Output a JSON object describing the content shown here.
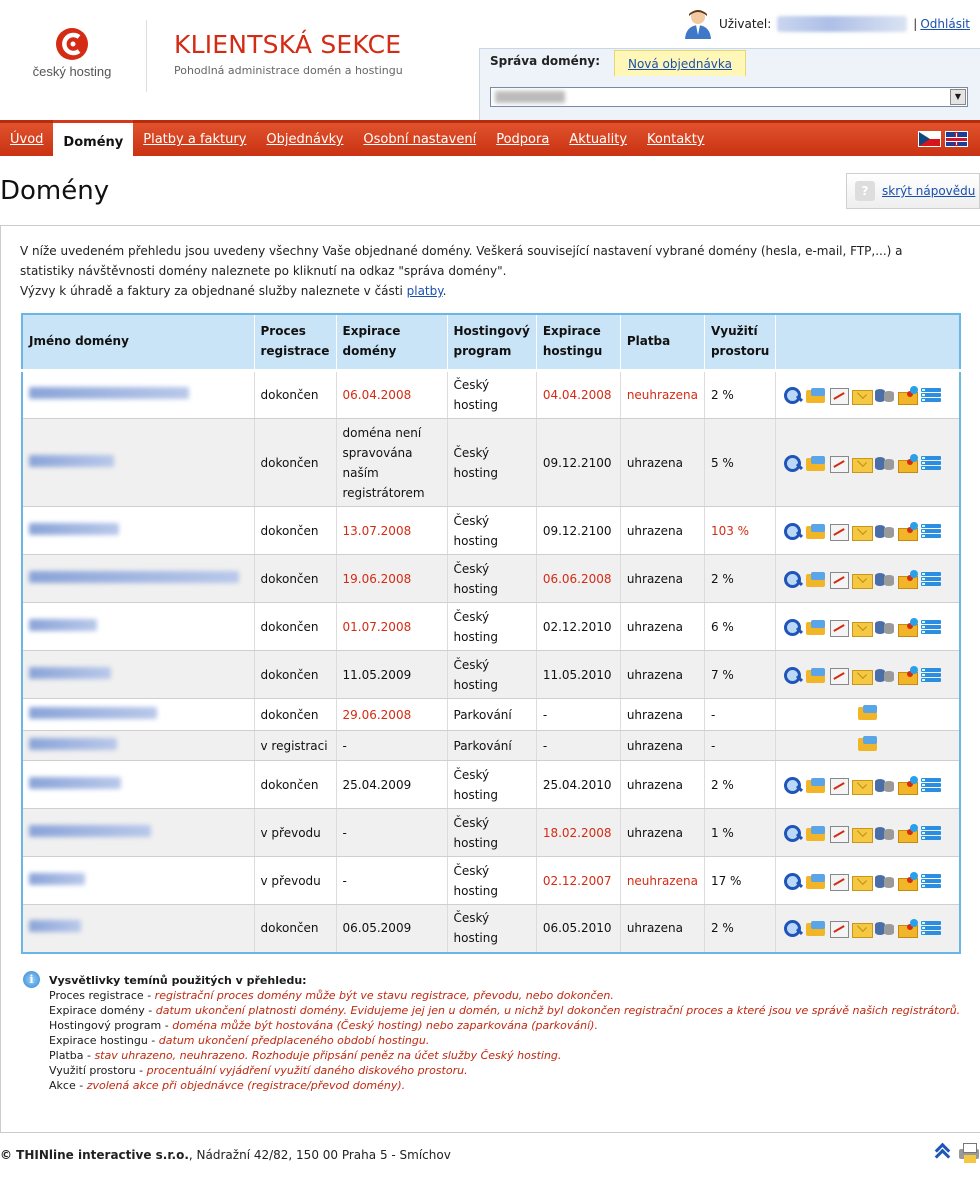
{
  "brand": {
    "logo_text": "český hosting",
    "title": "KLIENTSKÁ SEKCE",
    "subtitle": "Pohodlná administrace domén a hostingu"
  },
  "user": {
    "label": "Uživatel:",
    "separator": "|",
    "logout": "Odhlásit"
  },
  "domain_box": {
    "tab_manage": "Správa domény:",
    "tab_new_order": "Nová objednávka"
  },
  "nav": {
    "items": [
      {
        "label": "Úvod"
      },
      {
        "label": "Domény"
      },
      {
        "label": "Platby a faktury"
      },
      {
        "label": "Objednávky"
      },
      {
        "label": "Osobní nastavení"
      },
      {
        "label": "Podpora"
      },
      {
        "label": "Aktuality"
      },
      {
        "label": "Kontakty"
      }
    ],
    "active": "Domény"
  },
  "page": {
    "title": "Domény",
    "help_toggle": "skrýt nápovědu",
    "help_icon": "?"
  },
  "intro": {
    "line1": "V níže uvedeném přehledu jsou uvedeny všechny Vaše objednané domény. Veškerá související nastavení vybrané domény (hesla, e-mail, FTP,...) a statistiky návštěvnosti domény naleznete po kliknutí na odkaz \"správa domény\".",
    "line2_prefix": "Výzvy k úhradě a faktury za objednané služby naleznete v části ",
    "line2_link": "platby",
    "line2_suffix": "."
  },
  "table": {
    "headers": [
      "Jméno domény",
      "Proces registrace",
      "Expirace domény",
      "Hostingový program",
      "Expirace hostingu",
      "Platba",
      "Využití prostoru",
      ""
    ],
    "rows": [
      {
        "proc": "dokončen",
        "exp_dom": "06.04.2008",
        "exp_dom_red": true,
        "prog": "Český hosting",
        "exp_host": "04.04.2008",
        "exp_host_red": true,
        "platba": "neuhrazena",
        "platba_red": true,
        "vyuziti": "2 %",
        "vyuziti_red": false,
        "actions": "full"
      },
      {
        "proc": "dokončen",
        "exp_dom": "doména není spravována naším registrátorem",
        "exp_dom_red": false,
        "prog": "Český hosting",
        "exp_host": "09.12.2100",
        "exp_host_red": false,
        "platba": "uhrazena",
        "platba_red": false,
        "vyuziti": "5 %",
        "vyuziti_red": false,
        "actions": "full"
      },
      {
        "proc": "dokončen",
        "exp_dom": "13.07.2008",
        "exp_dom_red": true,
        "prog": "Český hosting",
        "exp_host": "09.12.2100",
        "exp_host_red": false,
        "platba": "uhrazena",
        "platba_red": false,
        "vyuziti": "103 %",
        "vyuziti_red": true,
        "actions": "full"
      },
      {
        "proc": "dokončen",
        "exp_dom": "19.06.2008",
        "exp_dom_red": true,
        "prog": "Český hosting",
        "exp_host": "06.06.2008",
        "exp_host_red": true,
        "platba": "uhrazena",
        "platba_red": false,
        "vyuziti": "2 %",
        "vyuziti_red": false,
        "actions": "full"
      },
      {
        "proc": "dokončen",
        "exp_dom": "01.07.2008",
        "exp_dom_red": true,
        "prog": "Český hosting",
        "exp_host": "02.12.2010",
        "exp_host_red": false,
        "platba": "uhrazena",
        "platba_red": false,
        "vyuziti": "6 %",
        "vyuziti_red": false,
        "actions": "full"
      },
      {
        "proc": "dokončen",
        "exp_dom": "11.05.2009",
        "exp_dom_red": false,
        "prog": "Český hosting",
        "exp_host": "11.05.2010",
        "exp_host_red": false,
        "platba": "uhrazena",
        "platba_red": false,
        "vyuziti": "7 %",
        "vyuziti_red": false,
        "actions": "full"
      },
      {
        "proc": "dokončen",
        "exp_dom": "29.06.2008",
        "exp_dom_red": true,
        "prog": "Parkování",
        "exp_host": "-",
        "exp_host_red": false,
        "platba": "uhrazena",
        "platba_red": false,
        "vyuziti": "-",
        "vyuziti_red": false,
        "actions": "folder"
      },
      {
        "proc": "v registraci",
        "exp_dom": "-",
        "exp_dom_red": false,
        "prog": "Parkování",
        "exp_host": "-",
        "exp_host_red": false,
        "platba": "uhrazena",
        "platba_red": false,
        "vyuziti": "-",
        "vyuziti_red": false,
        "actions": "folder"
      },
      {
        "proc": "dokončen",
        "exp_dom": "25.04.2009",
        "exp_dom_red": false,
        "prog": "Český hosting",
        "exp_host": "25.04.2010",
        "exp_host_red": false,
        "platba": "uhrazena",
        "platba_red": false,
        "vyuziti": "2 %",
        "vyuziti_red": false,
        "actions": "full"
      },
      {
        "proc": "v převodu",
        "exp_dom": "-",
        "exp_dom_red": false,
        "prog": "Český hosting",
        "exp_host": "18.02.2008",
        "exp_host_red": true,
        "platba": "uhrazena",
        "platba_red": false,
        "vyuziti": "1 %",
        "vyuziti_red": false,
        "actions": "full"
      },
      {
        "proc": "v převodu",
        "exp_dom": "-",
        "exp_dom_red": false,
        "prog": "Český hosting",
        "exp_host": "02.12.2007",
        "exp_host_red": true,
        "platba": "neuhrazena",
        "platba_red": true,
        "vyuziti": "17 %",
        "vyuziti_red": false,
        "actions": "full"
      },
      {
        "proc": "dokončen",
        "exp_dom": "06.05.2009",
        "exp_dom_red": false,
        "prog": "Český hosting",
        "exp_host": "06.05.2010",
        "exp_host_red": false,
        "platba": "uhrazena",
        "platba_red": false,
        "vyuziti": "2 %",
        "vyuziti_red": false,
        "actions": "full"
      }
    ]
  },
  "legend": {
    "icon": "i",
    "title": "Vysvětlivky temínů použitých v přehledu:",
    "items": [
      {
        "term": "Proces registrace",
        "def": "registrační proces domény může být ve stavu registrace, převodu, nebo dokončen."
      },
      {
        "term": "Expirace domény",
        "def": "datum ukončení platnosti domény. Evidujeme jej jen u domén, u nichž byl dokončen registrační proces a které jsou ve správě našich registrátorů."
      },
      {
        "term": "Hostingový program",
        "def": "doména může být hostována (Český hosting) nebo zaparkována (parkování)."
      },
      {
        "term": "Expirace hostingu",
        "def": "datum ukončení předplaceného období hostingu."
      },
      {
        "term": "Platba",
        "def": "stav uhrazeno, neuhrazeno. Rozhoduje připsání peněz na účet služby Český hosting."
      },
      {
        "term": "Využití prostoru",
        "def": "procentuální vyjádření využití daného diskového prostoru."
      },
      {
        "term": "Akce",
        "def": "zvolená akce při objednávce (registrace/převod domény)."
      }
    ]
  },
  "footer": {
    "company": "© THINline interactive s.r.o.",
    "address": ", Nádražní 42/82, 150 00 Praha 5 - Smíchov"
  },
  "colors": {
    "accent": "#d42b14",
    "nav": "#c93212",
    "table_header": "#c9e4f6",
    "table_border": "#6ab6e6"
  },
  "icons": [
    "logo-icon",
    "user-icon",
    "search-icon",
    "folder-icon",
    "chart-icon",
    "mail-icon",
    "database-icon",
    "package-icon",
    "list-icon",
    "info-icon",
    "to-top-icon",
    "print-icon",
    "help-icon",
    "flag-cz-icon",
    "flag-en-icon"
  ]
}
